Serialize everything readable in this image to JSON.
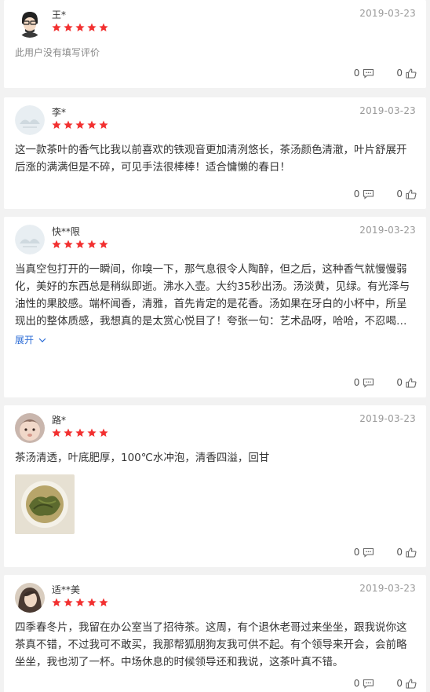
{
  "reviews": [
    {
      "name": "王*",
      "date": "2019-03-23",
      "text": "此用户没有填写评价",
      "likes": "0",
      "comments": "0"
    },
    {
      "name": "李*",
      "date": "2019-03-23",
      "text": "这一款茶叶的香气比我以前喜欢的铁观音更加清洌悠长，茶汤颜色清澈，叶片舒展开后涨的满满但是不碎，可见手法很棒棒！适合慵懒的春日！",
      "likes": "0",
      "comments": "0"
    },
    {
      "name": "快**限",
      "date": "2019-03-23",
      "text": "当真空包打开的一瞬间，你嗅一下，那气息很令人陶醉，但之后，这种香气就慢慢弱化，美好的东西总是稍纵即逝。沸水入壶。大约35秒出汤。汤淡黄，见绿。有光泽与油性的果胶感。端杯闻香，清雅，首先肯定的是花香。汤如果在牙白的小杯中，所呈现出的整体质感，我想真的是太赏心悦目了！夸张一句：艺术品呀，哈哈，不忍喝。 轻啜，滑润，清甜。回甘这个时候并没有格外注意，饮尽。细闻杯底香气，依然清雅。",
      "expand_label": "展开",
      "likes": "0",
      "comments": "0"
    },
    {
      "name": "路*",
      "date": "2019-03-23",
      "text": "茶汤清透，叶底肥厚，100℃水冲泡，清香四溢，回甘",
      "likes": "0",
      "comments": "0"
    },
    {
      "name": "适**美",
      "date": "2019-03-23",
      "text": "四季春冬片，我留在办公室当了招待茶。这周，有个退休老哥过来坐坐，跟我说你这茶真不错，不过我可不敢买，我那帮狐朋狗友我可供不起。有个领导来开会，会前略坐坐，我也沏了一杯。中场休息的时候领导还和我说，这茶叶真不错。",
      "likes": "0",
      "comments": "0"
    }
  ],
  "colors": {
    "star": "#f23030",
    "link": "#2a6bd6"
  },
  "icons": {
    "comment": "comment-icon",
    "like": "thumbs-up-icon",
    "expand": "chevron-down-icon"
  }
}
